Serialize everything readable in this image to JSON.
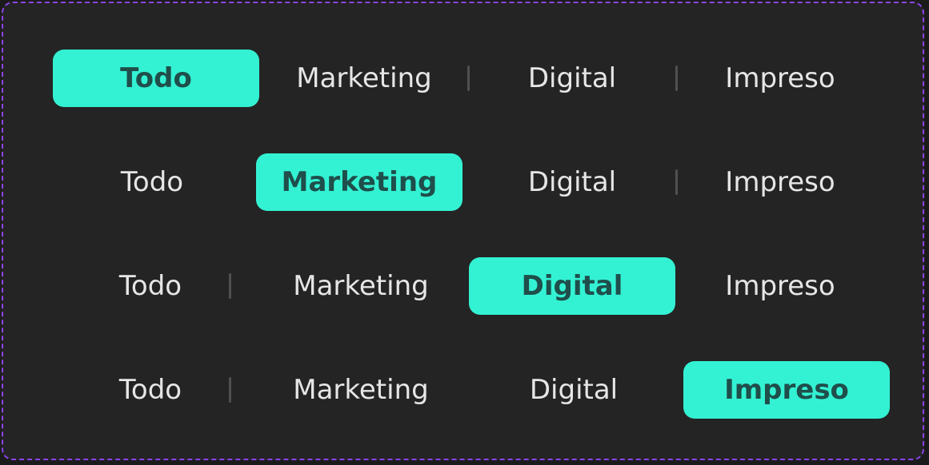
{
  "accent": "#33f2d3",
  "rows": [
    {
      "tabs": [
        "Todo",
        "Marketing",
        "Digital",
        "Impreso"
      ],
      "selected": "Todo"
    },
    {
      "tabs": [
        "Todo",
        "Marketing",
        "Digital",
        "Impreso"
      ],
      "selected": "Marketing"
    },
    {
      "tabs": [
        "Todo",
        "Marketing",
        "Digital",
        "Impreso"
      ],
      "selected": "Digital"
    },
    {
      "tabs": [
        "Todo",
        "Marketing",
        "Digital",
        "Impreso"
      ],
      "selected": "Impreso"
    }
  ]
}
